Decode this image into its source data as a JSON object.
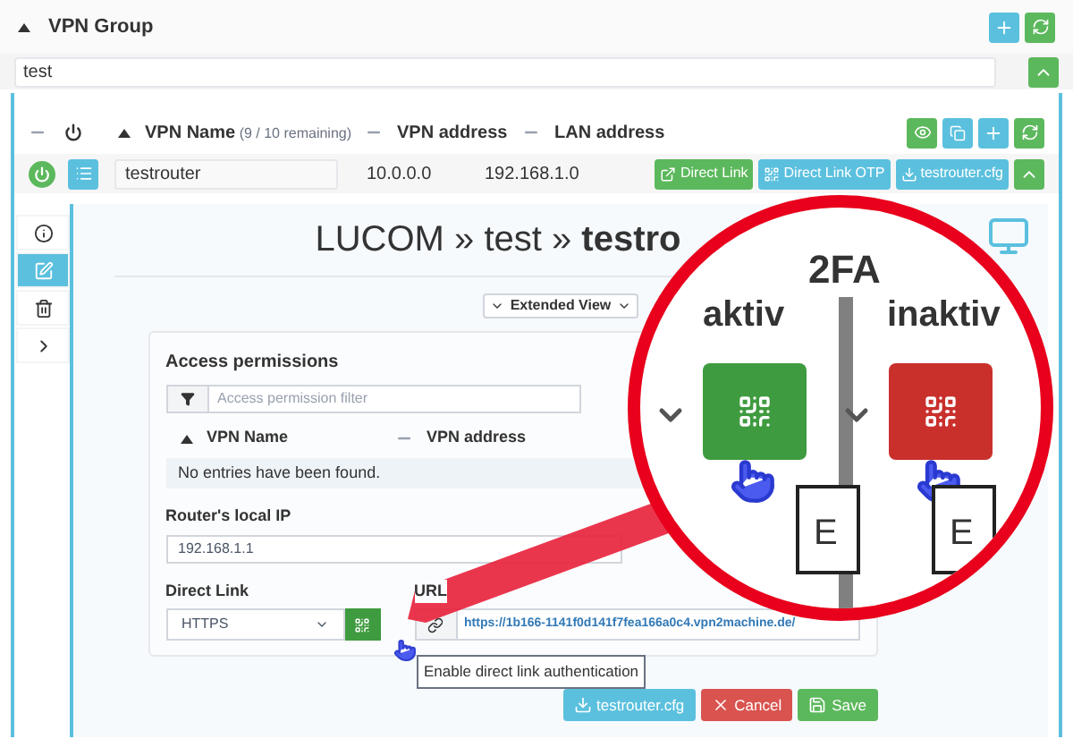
{
  "group": {
    "title": "VPN Group",
    "name_value": "test"
  },
  "vpn_table": {
    "columns": [
      {
        "label": "VPN Name",
        "note": "(9 / 10 remaining)",
        "sorted": true
      },
      {
        "label": "VPN address",
        "sorted": false
      },
      {
        "label": "LAN address",
        "sorted": false
      }
    ],
    "rows": [
      {
        "enabled": true,
        "name": "testrouter",
        "vpn_address": "10.0.0.0",
        "lan_address": "192.168.1.0",
        "actions": [
          {
            "label": "Direct Link",
            "kind": "link",
            "color": "#5cb85c"
          },
          {
            "label": "Direct Link OTP",
            "kind": "qr",
            "color": "#5bc0de"
          },
          {
            "label": "testrouter.cfg",
            "kind": "download",
            "color": "#5bc0de"
          }
        ]
      }
    ]
  },
  "side_tabs": [
    {
      "kind": "info",
      "selected": false
    },
    {
      "kind": "edit",
      "selected": true
    },
    {
      "kind": "delete",
      "selected": false
    },
    {
      "kind": "more",
      "selected": false
    }
  ],
  "detail": {
    "title_plain": "LUCOM » test » ",
    "title_bold": "testro",
    "view_select": "Extended View",
    "access": {
      "title": "Access permissions",
      "filter_placeholder": "Access permission filter",
      "columns": [
        "VPN Name",
        "VPN address"
      ],
      "empty": "No entries have been found."
    },
    "local_ip": {
      "label": "Router's local IP",
      "value": "192.168.1.1"
    },
    "direct_link": {
      "label": "Direct Link",
      "protocol": "HTTPS",
      "auth_enabled": true,
      "tooltip": "Enable direct link authentication"
    },
    "url": {
      "label": "URL",
      "value": "https://1b166-1141f0d141f7fea166a0c4.vpn2machine.de/"
    },
    "buttons": [
      {
        "label": "testrouter.cfg",
        "kind": "download"
      },
      {
        "label": "Cancel",
        "kind": "cancel"
      },
      {
        "label": "Save",
        "kind": "save"
      }
    ]
  },
  "magnifier": {
    "title": "2FA",
    "panels": [
      {
        "label": "aktiv",
        "active": true,
        "fragment": "E"
      },
      {
        "label": "inaktiv",
        "active": false,
        "fragment": "E"
      }
    ]
  }
}
